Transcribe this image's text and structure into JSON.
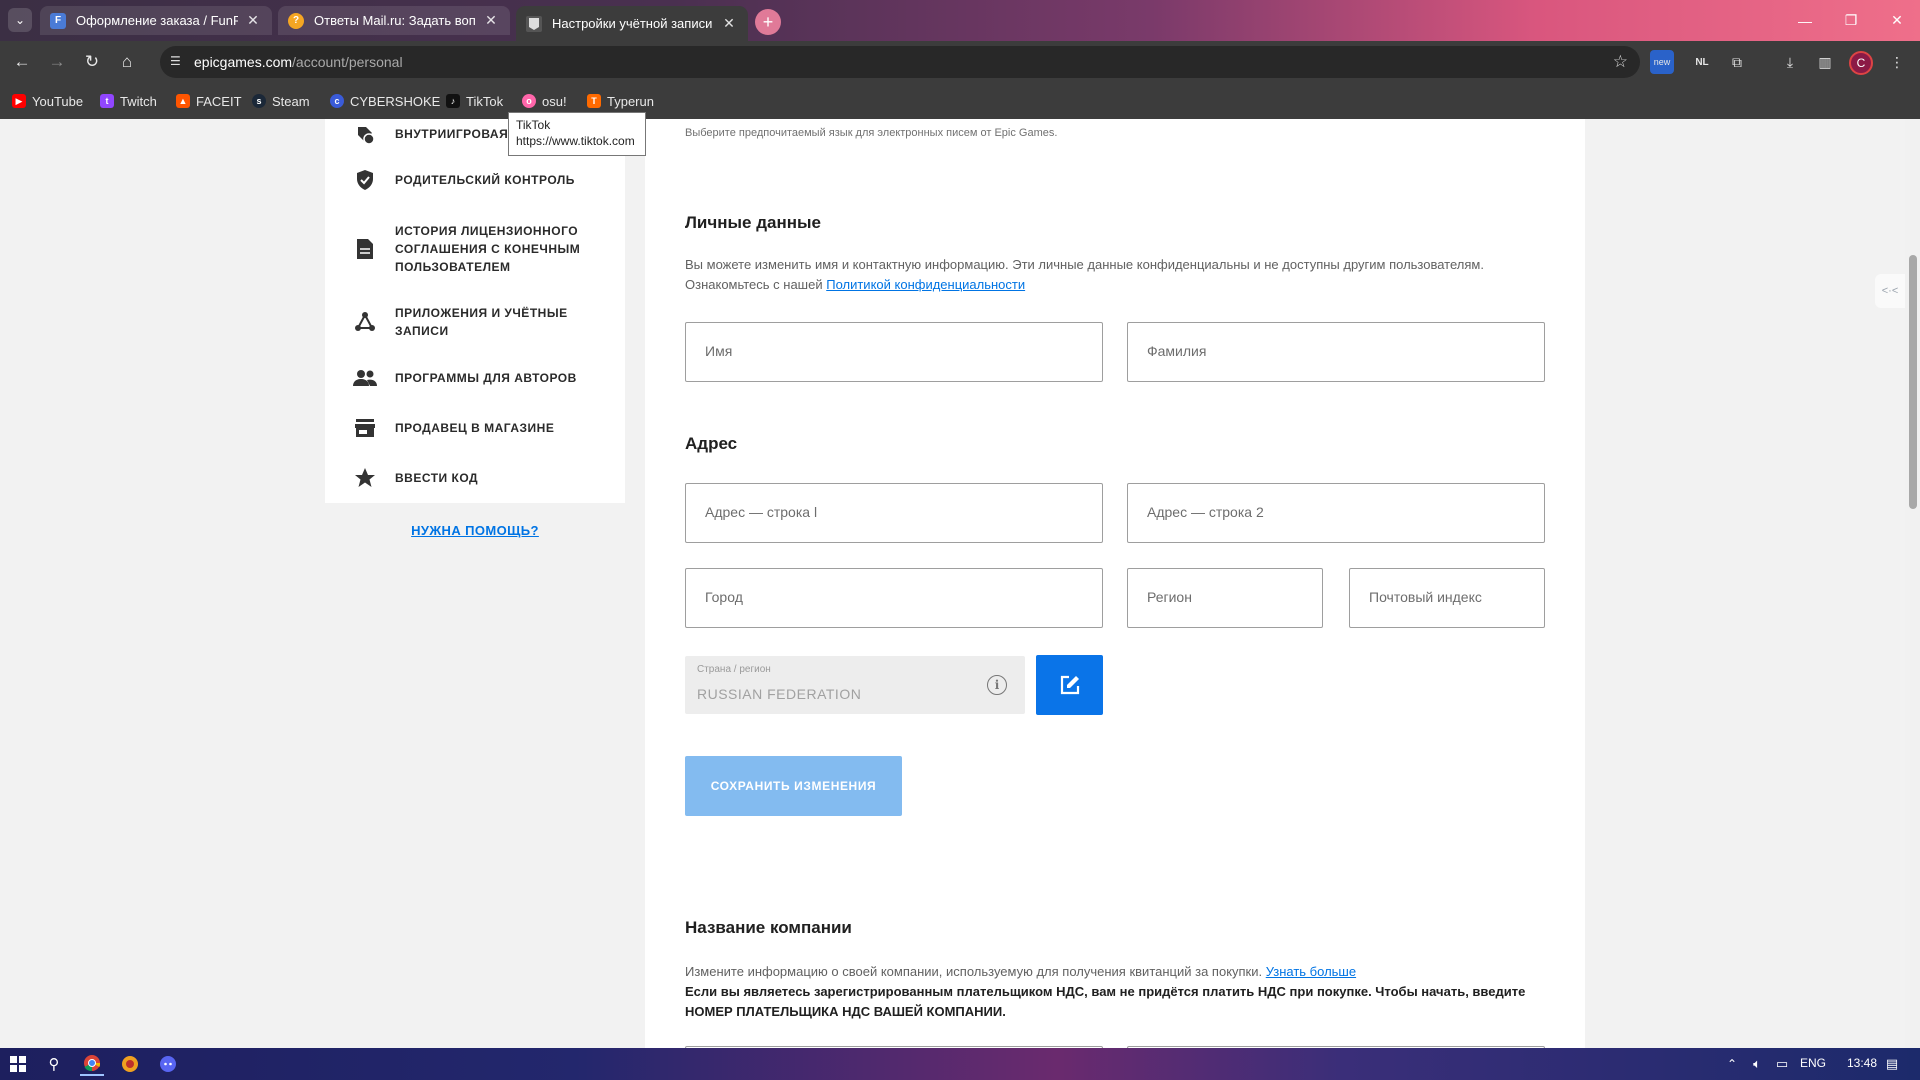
{
  "browser": {
    "tabs": [
      {
        "title": "Оформление заказа / FunPay",
        "favicon": "F",
        "favicon_color": "#4a7bd6",
        "active": false
      },
      {
        "title": "Ответы Mail.ru: Задать вопрос",
        "favicon": "?",
        "favicon_color": "#f5a623",
        "active": false
      },
      {
        "title": "Настройки учётной записи",
        "favicon": "epic",
        "favicon_color": "#2f2f2f",
        "active": true
      }
    ],
    "url_host": "epicgames.com",
    "url_path": "/account/personal",
    "profile_initial": "C",
    "bookmarks": [
      {
        "label": "YouTube",
        "color": "#ff0000"
      },
      {
        "label": "Twitch",
        "color": "#9146ff"
      },
      {
        "label": "FACEIT",
        "color": "#ff5500"
      },
      {
        "label": "Steam",
        "color": "#1b2838"
      },
      {
        "label": "CYBERSHOKE",
        "color": "#3a5bd9"
      },
      {
        "label": "TikTok",
        "color": "#111111"
      },
      {
        "label": "osu!",
        "color": "#ff66aa"
      },
      {
        "label": "Typerun",
        "color": "#ff6a00"
      }
    ],
    "tooltip": {
      "title": "TikTok",
      "url": "https://www.tiktok.com"
    }
  },
  "sidebar": {
    "items": [
      {
        "label": "Внутриигровая в",
        "icon": "ingame-currency-icon"
      },
      {
        "label": "Родительский контроль",
        "icon": "shield-check-icon"
      },
      {
        "label": "История лицензионного соглашения с конечным пользователем",
        "icon": "document-icon"
      },
      {
        "label": "Приложения и учётные записи",
        "icon": "connections-icon"
      },
      {
        "label": "Программы для авторов",
        "icon": "people-icon"
      },
      {
        "label": "Продавец в магазине",
        "icon": "store-icon"
      },
      {
        "label": "Ввести код",
        "icon": "star-icon"
      }
    ],
    "help_link": "НУЖНА ПОМОЩЬ?"
  },
  "main": {
    "language_desc": "Выберите предпочитаемый язык для электронных писем от Epic Games.",
    "personal": {
      "title": "Личные данные",
      "desc_before": "Вы можете изменить имя и контактную информацию. Эти личные данные конфиденциальны и не доступны другим пользователям. Ознакомьтесь с нашей ",
      "desc_link": "Политикой конфиденциальности",
      "first_name_placeholder": "Имя",
      "last_name_placeholder": "Фамилия"
    },
    "address": {
      "title": "Адрес",
      "line1_placeholder": "Адрес — строка l",
      "line2_placeholder": "Адрес — строка 2",
      "city_placeholder": "Город",
      "region_placeholder": "Регион",
      "postal_placeholder": "Почтовый индекс",
      "country_label": "Страна / регион",
      "country_value": "RUSSIAN FEDERATION"
    },
    "save_button": "СОХРАНИТЬ ИЗМЕНЕНИЯ",
    "company": {
      "title": "Название компании",
      "desc": "Измените информацию о своей компании, используемую для получения квитанций за покупки. ",
      "desc_link": "Узнать больше",
      "vat_note": "Если вы являетесь зарегистрированным плательщиком НДС, вам не придётся платить НДС при покупке. Чтобы начать, введите НОМЕР ПЛАТЕЛЬЩИКА НДС ВАШЕЙ КОМПАНИИ."
    }
  },
  "taskbar": {
    "lang": "ENG",
    "time": "13:48"
  },
  "colors": {
    "accent": "#0a74e8",
    "save_disabled": "#83bbf0",
    "link": "#0074e4"
  }
}
